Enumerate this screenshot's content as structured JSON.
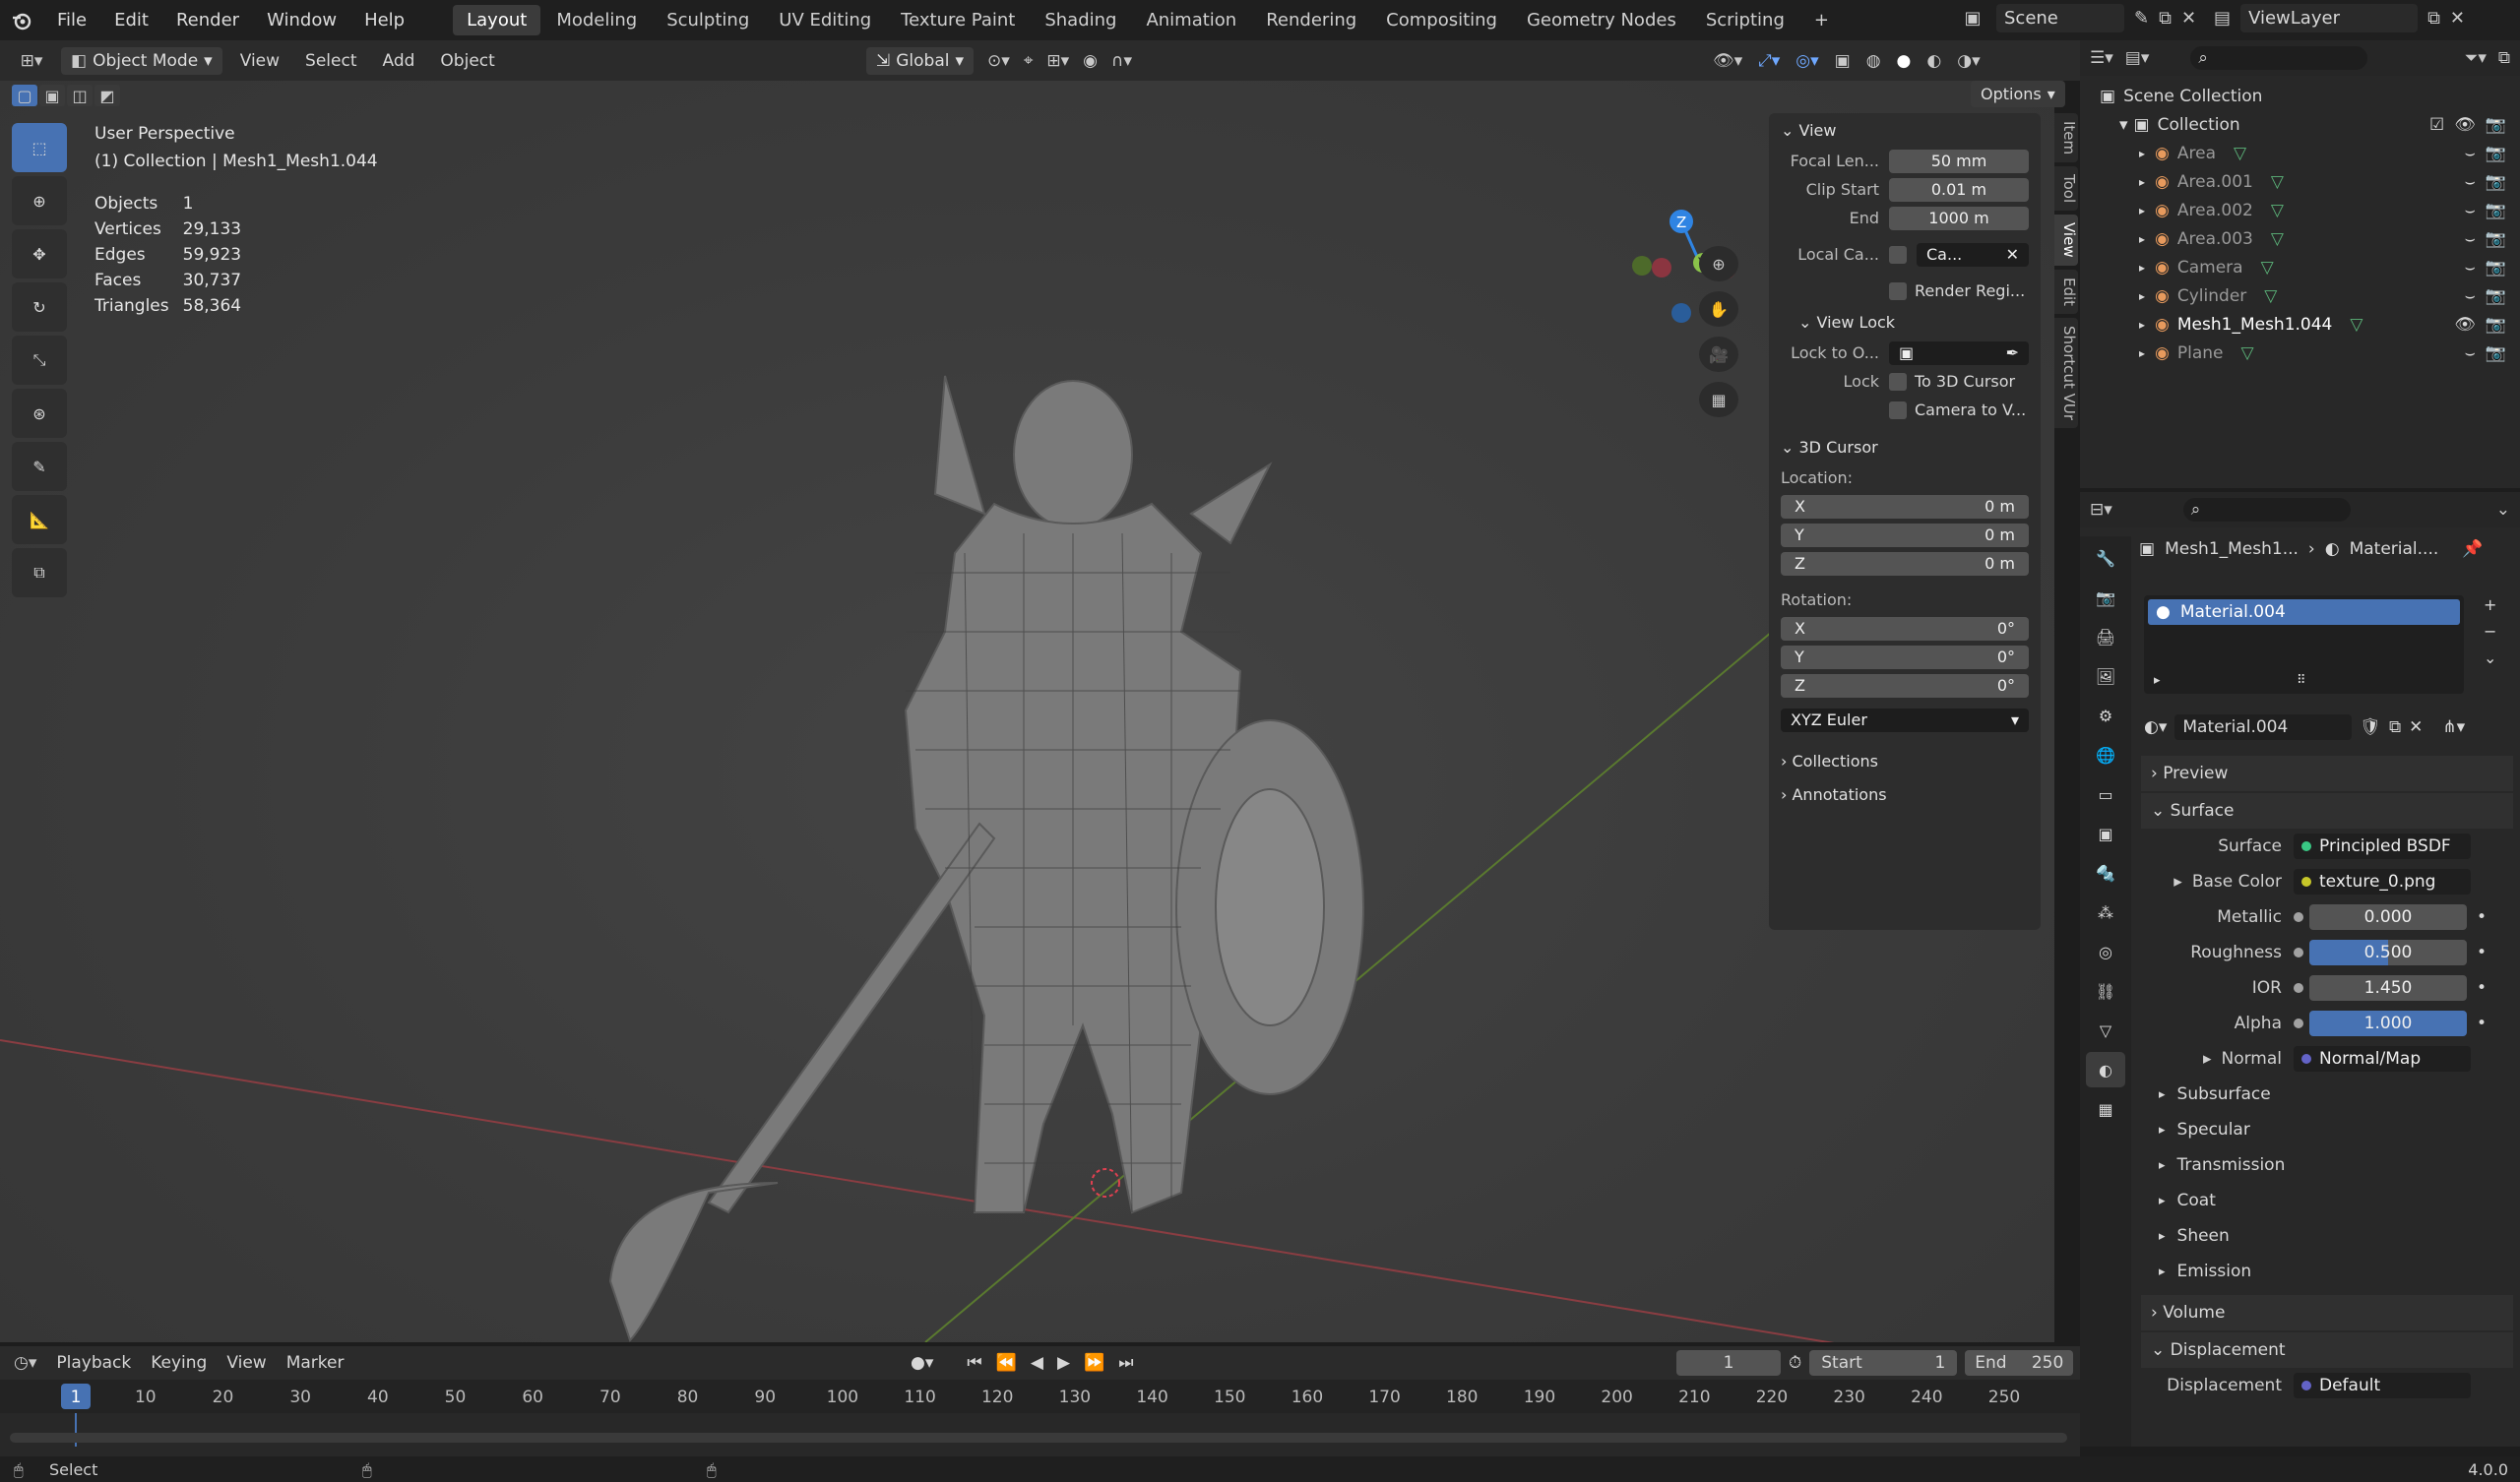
{
  "topbar": {
    "menus": [
      "File",
      "Edit",
      "Render",
      "Window",
      "Help"
    ],
    "workspaces": [
      "Layout",
      "Modeling",
      "Sculpting",
      "UV Editing",
      "Texture Paint",
      "Shading",
      "Animation",
      "Rendering",
      "Compositing",
      "Geometry Nodes",
      "Scripting"
    ],
    "active_workspace": "Layout",
    "add_tab": "+",
    "scene_label": "Scene",
    "viewlayer_label": "ViewLayer"
  },
  "viewport_header": {
    "mode": "Object Mode",
    "menus": [
      "View",
      "Select",
      "Add",
      "Object"
    ],
    "transform_orientation": "Global",
    "options": "Options"
  },
  "viewport": {
    "view_name": "User Perspective",
    "collection_line": "(1) Collection | Mesh1_Mesh1.044",
    "stats": [
      {
        "label": "Objects",
        "value": "1"
      },
      {
        "label": "Vertices",
        "value": "29,133"
      },
      {
        "label": "Edges",
        "value": "59,923"
      },
      {
        "label": "Faces",
        "value": "30,737"
      },
      {
        "label": "Triangles",
        "value": "58,364"
      }
    ],
    "gizmo": {
      "x": "X",
      "y": "Y",
      "z": "Z"
    }
  },
  "npanel": {
    "view_title": "View",
    "focal_label": "Focal Len...",
    "focal_value": "50 mm",
    "clip_start_label": "Clip Start",
    "clip_start_value": "0.01 m",
    "clip_end_label": "End",
    "clip_end_value": "1000 m",
    "local_camera_label": "Local Ca...",
    "local_camera_value": "Ca...",
    "render_region": "Render Regi...",
    "view_lock_title": "View Lock",
    "lock_to_label": "Lock to O...",
    "lock_label": "Lock",
    "to_cursor": "To 3D Cursor",
    "camera_to_view": "Camera to V...",
    "cursor_title": "3D Cursor",
    "location_label": "Location:",
    "loc": [
      {
        "axis": "X",
        "value": "0 m"
      },
      {
        "axis": "Y",
        "value": "0 m"
      },
      {
        "axis": "Z",
        "value": "0 m"
      }
    ],
    "rotation_label": "Rotation:",
    "rot": [
      {
        "axis": "X",
        "value": "0°"
      },
      {
        "axis": "Y",
        "value": "0°"
      },
      {
        "axis": "Z",
        "value": "0°"
      }
    ],
    "rotation_mode": "XYZ Euler",
    "collections": "Collections",
    "annotations": "Annotations"
  },
  "side_tabs": [
    "Item",
    "Tool",
    "View",
    "Edit",
    "Shortcut VUr"
  ],
  "outliner": {
    "scene_collection": "Scene Collection",
    "collection": "Collection",
    "items": [
      {
        "name": "Area",
        "active": false
      },
      {
        "name": "Area.001",
        "active": false
      },
      {
        "name": "Area.002",
        "active": false
      },
      {
        "name": "Area.003",
        "active": false
      },
      {
        "name": "Camera",
        "active": false
      },
      {
        "name": "Cylinder",
        "active": false
      },
      {
        "name": "Mesh1_Mesh1.044",
        "active": true
      },
      {
        "name": "Plane",
        "active": false
      }
    ]
  },
  "properties": {
    "breadcrumb_object": "Mesh1_Mesh1...",
    "breadcrumb_material": "Material....",
    "slot": "Material.004",
    "material_name": "Material.004",
    "preview": "Preview",
    "surface_section": "Surface",
    "surface_label": "Surface",
    "surface_value": "Principled BSDF",
    "base_color_label": "Base Color",
    "base_color_value": "texture_0.png",
    "metallic_label": "Metallic",
    "metallic_value": "0.000",
    "roughness_label": "Roughness",
    "roughness_value": "0.500",
    "ior_label": "IOR",
    "ior_value": "1.450",
    "alpha_label": "Alpha",
    "alpha_value": "1.000",
    "normal_label": "Normal",
    "normal_value": "Normal/Map",
    "subpanels": [
      "Subsurface",
      "Specular",
      "Transmission",
      "Coat",
      "Sheen",
      "Emission"
    ],
    "volume": "Volume",
    "displacement_section": "Displacement",
    "displacement_label": "Displacement",
    "displacement_value": "Default"
  },
  "timeline": {
    "menus": [
      "Playback",
      "Keying",
      "View",
      "Marker"
    ],
    "current_frame": "1",
    "start_label": "Start",
    "start_value": "1",
    "end_label": "End",
    "end_value": "250",
    "ticks": [
      "1",
      "10",
      "20",
      "30",
      "40",
      "50",
      "60",
      "70",
      "80",
      "90",
      "100",
      "110",
      "120",
      "130",
      "140",
      "150",
      "160",
      "170",
      "180",
      "190",
      "200",
      "210",
      "220",
      "230",
      "240",
      "250"
    ]
  },
  "statusbar": {
    "select": "Select",
    "version": "4.0.0"
  },
  "colors": {
    "accent": "#4772b3",
    "x_axis": "#e0404f",
    "y_axis": "#8bc34a",
    "z_axis": "#2f84e3"
  }
}
